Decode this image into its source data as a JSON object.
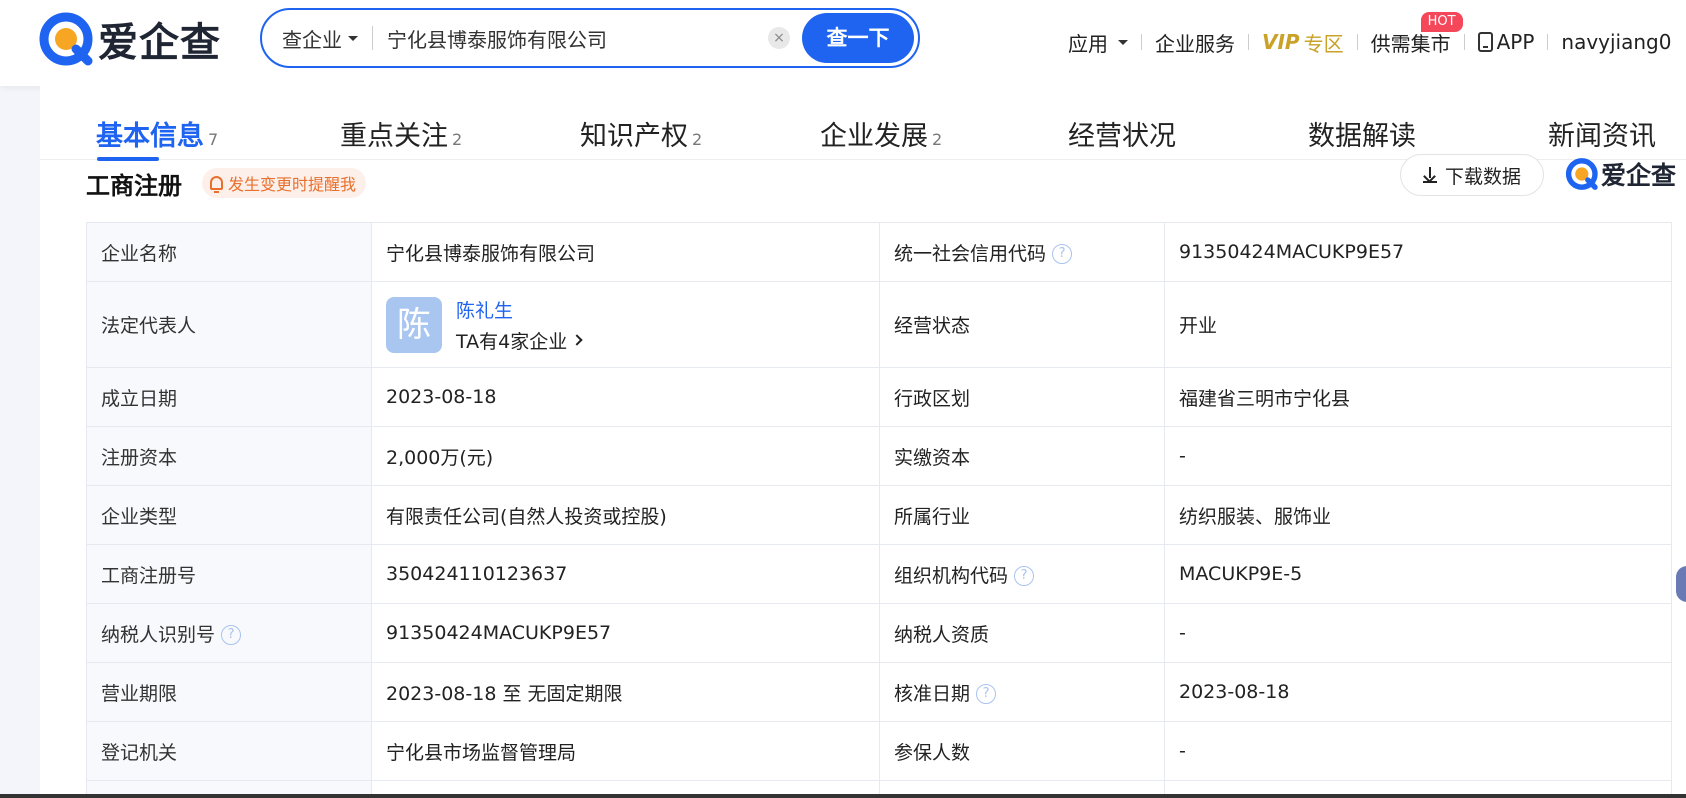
{
  "header": {
    "logo_text": "爱企查",
    "search": {
      "type_label": "查企业",
      "value": "宁化县博泰服饰有限公司",
      "clear_symbol": "×",
      "button_label": "查一下"
    },
    "nav": {
      "apps": "应用",
      "enterprise_service": "企业服务",
      "vip_text": "VIP",
      "vip_zone": "专区",
      "market": "供需集市",
      "hot_badge": "HOT",
      "app": "APP",
      "user": "navyjiang0"
    },
    "colors": {
      "brand_blue": "#1e64f0",
      "vip_gold": "#c9a227",
      "hot_red": "#f5475a"
    }
  },
  "tabs": [
    {
      "label": "基本信息",
      "count": "7"
    },
    {
      "label": "重点关注",
      "count": "2"
    },
    {
      "label": "知识产权",
      "count": "2"
    },
    {
      "label": "企业发展",
      "count": "2"
    },
    {
      "label": "经营状况",
      "count": ""
    },
    {
      "label": "数据解读",
      "count": ""
    },
    {
      "label": "新闻资讯",
      "count": ""
    }
  ],
  "section": {
    "title": "工商注册",
    "remind_label": "发生变更时提醒我",
    "download_label": "下载数据",
    "brand_small": "爱企查"
  },
  "table": {
    "rows": [
      {
        "l1": "企业名称",
        "v1": "宁化县博泰服饰有限公司",
        "l2": "统一社会信用代码",
        "v2": "91350424MACUKP9E57"
      },
      {
        "l1": "法定代表人",
        "person_name": "陈礼生",
        "avatar_char": "陈",
        "person_sub": "TA有4家企业",
        "l2": "经营状态",
        "v2": "开业"
      },
      {
        "l1": "成立日期",
        "v1": "2023-08-18",
        "l2": "行政区划",
        "v2": "福建省三明市宁化县"
      },
      {
        "l1": "注册资本",
        "v1": "2,000万(元)",
        "l2": "实缴资本",
        "v2": "-"
      },
      {
        "l1": "企业类型",
        "v1": "有限责任公司(自然人投资或控股)",
        "l2": "所属行业",
        "v2": "纺织服装、服饰业"
      },
      {
        "l1": "工商注册号",
        "v1": "350424110123637",
        "l2": "组织机构代码",
        "v2": "MACUKP9E-5"
      },
      {
        "l1": "纳税人识别号",
        "v1": "91350424MACUKP9E57",
        "l2": "纳税人资质",
        "v2": "-"
      },
      {
        "l1": "营业期限",
        "v1": "2023-08-18 至 无固定期限",
        "l2": "核准日期",
        "v2": "2023-08-18"
      },
      {
        "l1": "登记机关",
        "v1": "宁化县市场监督管理局",
        "l2": "参保人数",
        "v2": "-"
      }
    ],
    "help_symbol": "?"
  }
}
